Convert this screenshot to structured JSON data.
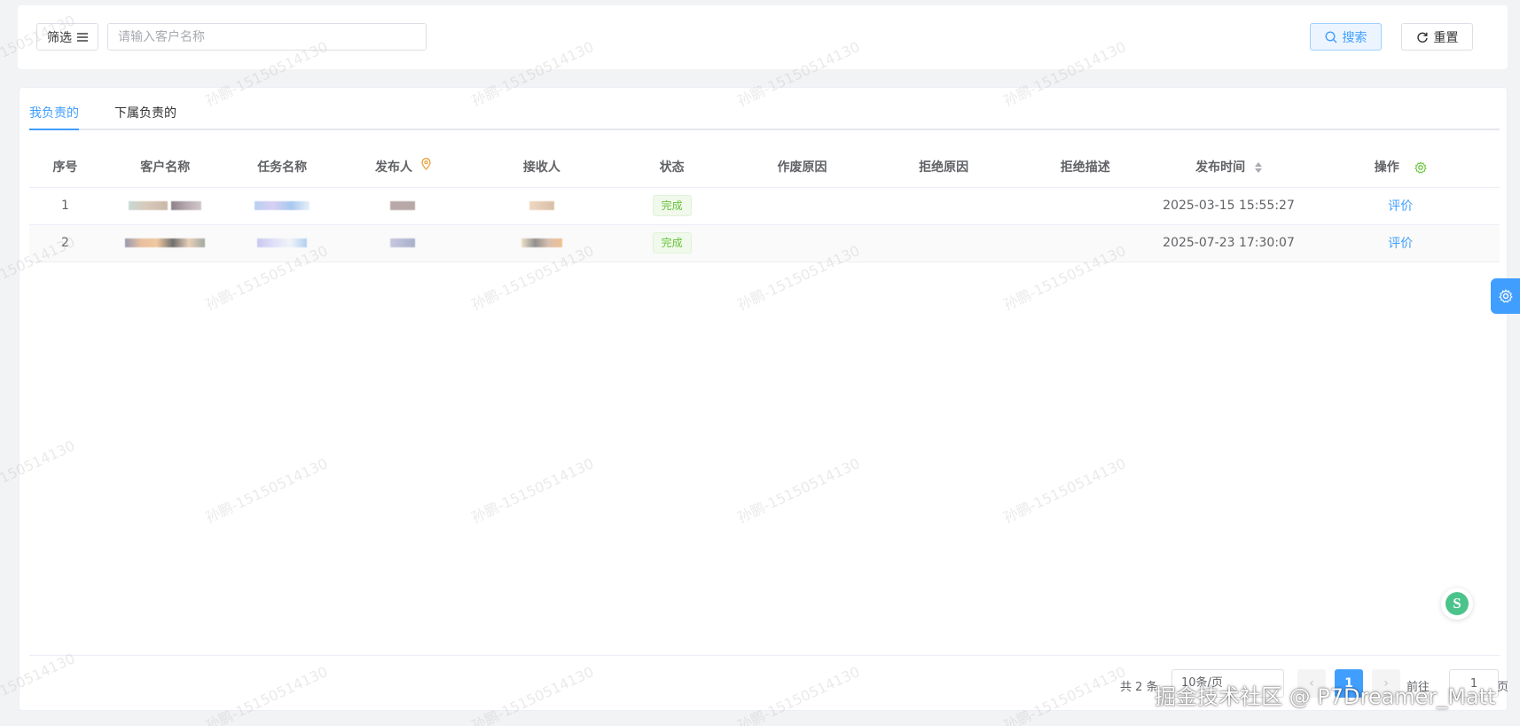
{
  "filter": {
    "filter_button_label": "筛选",
    "search_placeholder": "请输入客户名称",
    "search_button_label": "搜索",
    "reset_button_label": "重置"
  },
  "tabs": [
    {
      "label": "我负责的",
      "active": true
    },
    {
      "label": "下属负责的",
      "active": false
    }
  ],
  "table": {
    "columns": [
      "序号",
      "客户名称",
      "任务名称",
      "发布人",
      "接收人",
      "状态",
      "作废原因",
      "拒绝原因",
      "拒绝描述",
      "发布时间",
      "操作"
    ],
    "rows": [
      {
        "index": "1",
        "status": "完成",
        "publish_time": "2025-03-15 15:55:27",
        "action": "评价"
      },
      {
        "index": "2",
        "status": "完成",
        "publish_time": "2025-07-23 17:30:07",
        "action": "评价"
      }
    ]
  },
  "pagination": {
    "total": "共 2 条",
    "page_size": "10条/页",
    "current_page": "1",
    "goto_label": "前往",
    "goto_value": "1",
    "page_suffix": "页"
  },
  "watermark": "孙鹏-15150514130",
  "credit": "掘金技术社区 @ P7Dreamer_Matt",
  "colors": {
    "primary": "#409eff",
    "success": "#67c23a",
    "publisher_icon": "#e6a23c"
  },
  "icons": {
    "filter": "filter-lines-icon",
    "search": "search-icon",
    "reset": "refresh-icon",
    "publisher": "location-pin-icon",
    "column_settings": "gear-icon",
    "side_settings": "gear-icon"
  }
}
